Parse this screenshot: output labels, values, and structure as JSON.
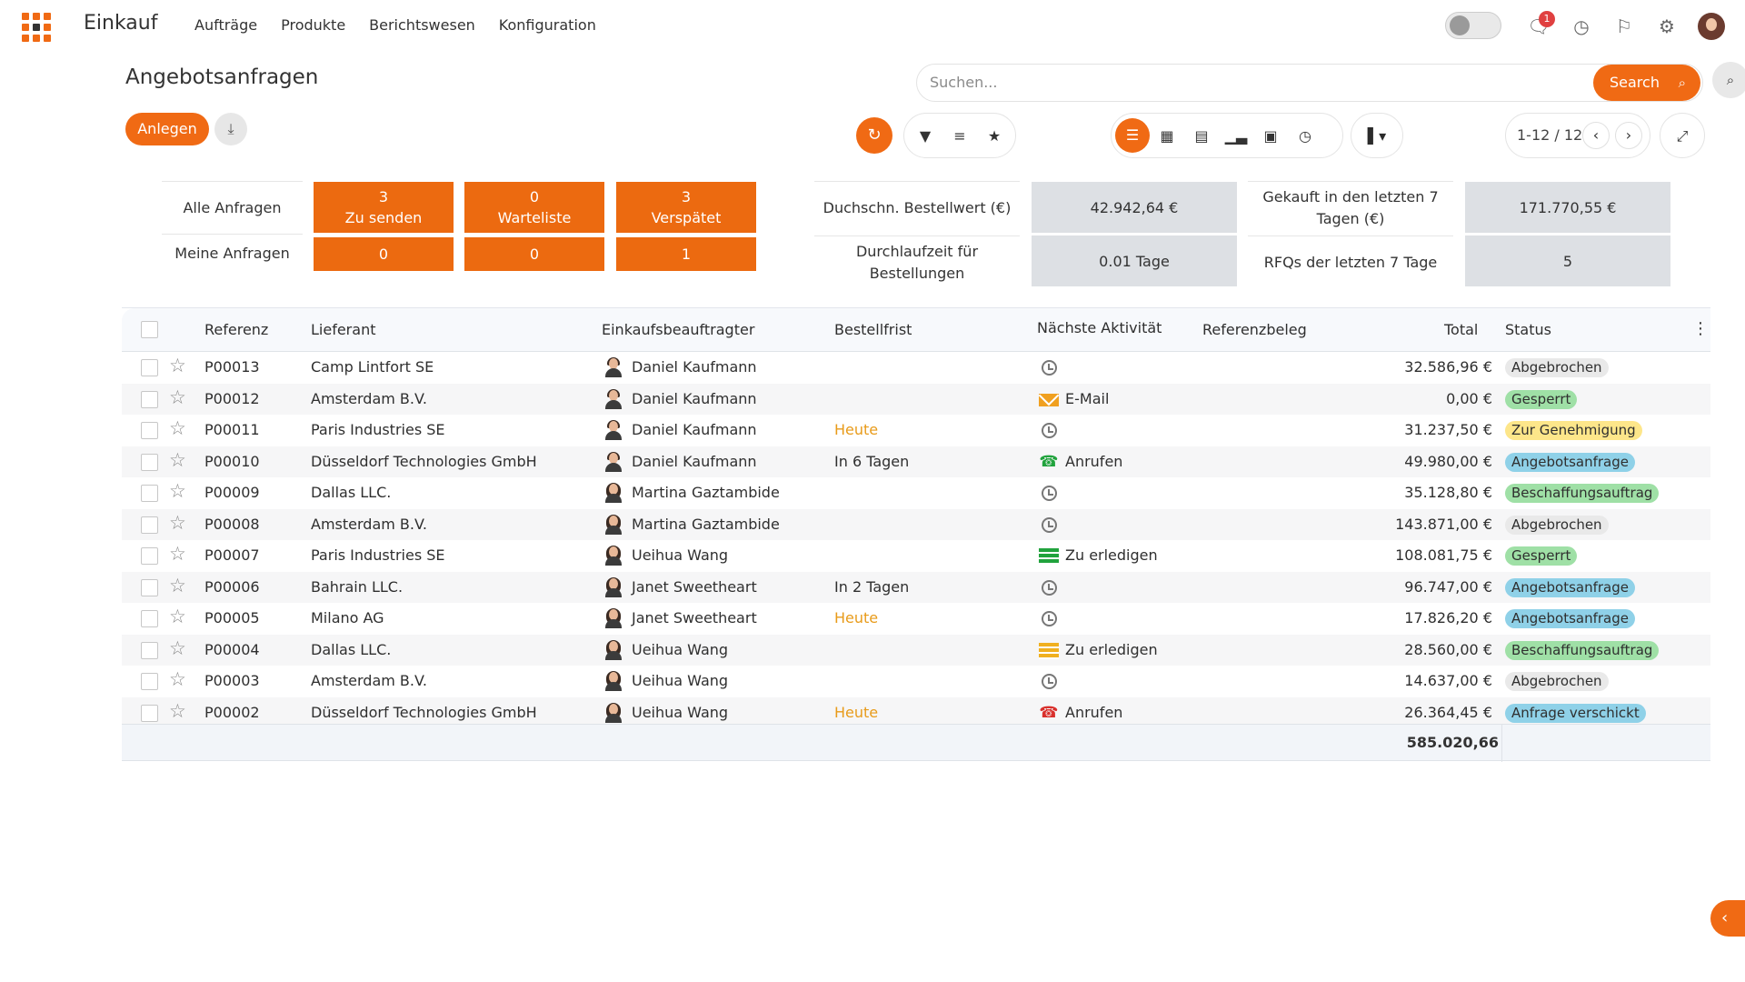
{
  "app": {
    "title": "Einkauf"
  },
  "nav": {
    "items": [
      "Aufträge",
      "Produkte",
      "Berichtswesen",
      "Konfiguration"
    ]
  },
  "header": {
    "notification_count": "1"
  },
  "page": {
    "title": "Angebotsanfragen"
  },
  "search": {
    "placeholder": "Suchen...",
    "button_label": "Search"
  },
  "actions": {
    "create_label": "Anlegen"
  },
  "pager": {
    "range": "1-12 / 12"
  },
  "dashboard": {
    "row_labels": [
      "Alle Anfragen",
      "Meine Anfragen"
    ],
    "tiles": [
      {
        "count_all": "3",
        "label": "Zu senden",
        "count_mine": "0"
      },
      {
        "count_all": "0",
        "label": "Warteliste",
        "count_mine": "0"
      },
      {
        "count_all": "3",
        "label": "Verspätet",
        "count_mine": "1"
      }
    ],
    "kpis": [
      {
        "label": "Duchschn. Bestellwert (€)",
        "value": "42.942,64 €"
      },
      {
        "label": "Gekauft in den letzten 7 Tagen (€)",
        "value": "171.770,55 €"
      },
      {
        "label": "Durchlaufzeit für Bestellungen",
        "value": "0.01  Tage"
      },
      {
        "label": "RFQs der letzten 7 Tage",
        "value": "5"
      }
    ]
  },
  "table": {
    "columns": [
      "Referenz",
      "Lieferant",
      "Einkaufsbeauftragter",
      "Bestellfrist",
      "Nächste Aktivität",
      "Referenzbeleg",
      "Total",
      "Status"
    ],
    "rows": [
      {
        "ref": "P00013",
        "supplier": "Camp Lintfort SE",
        "buyer": "Daniel Kaufmann",
        "deadline": "",
        "activity": "",
        "activity_icon": "clock-icon",
        "total": "32.586,96 €",
        "status": "Abgebrochen",
        "status_color": "#e9e9e9"
      },
      {
        "ref": "P00012",
        "supplier": "Amsterdam B.V.",
        "buyer": "Daniel Kaufmann",
        "deadline": "",
        "activity": "E-Mail",
        "activity_icon": "envelope-icon",
        "total": "0,00 €",
        "status": "Gesperrt",
        "status_color": "#9fe0a6"
      },
      {
        "ref": "P00011",
        "supplier": "Paris Industries SE",
        "buyer": "Daniel Kaufmann",
        "deadline": "Heute",
        "activity": "",
        "activity_icon": "clock-icon",
        "total": "31.237,50 €",
        "status": "Zur Genehmigung",
        "status_color": "#fde68a"
      },
      {
        "ref": "P00010",
        "supplier": "Düsseldorf Technologies GmbH",
        "buyer": "Daniel Kaufmann",
        "deadline": "In 6 Tagen",
        "activity": "Anrufen",
        "activity_icon": "phone-icon",
        "total": "49.980,00 €",
        "status": "Angebotsanfrage",
        "status_color": "#8fd1e8"
      },
      {
        "ref": "P00009",
        "supplier": "Dallas LLC.",
        "buyer": "Martina Gaztambide",
        "deadline": "",
        "activity": "",
        "activity_icon": "clock-icon",
        "total": "35.128,80 €",
        "status": "Beschaffungsauftrag",
        "status_color": "#9fe0a6"
      },
      {
        "ref": "P00008",
        "supplier": "Amsterdam B.V.",
        "buyer": "Martina Gaztambide",
        "deadline": "",
        "activity": "",
        "activity_icon": "clock-icon",
        "total": "143.871,00 €",
        "status": "Abgebrochen",
        "status_color": "#e9e9e9"
      },
      {
        "ref": "P00007",
        "supplier": "Paris Industries SE",
        "buyer": "Ueihua Wang",
        "deadline": "",
        "activity": "Zu erledigen",
        "activity_icon": "todo-icon",
        "total": "108.081,75 €",
        "status": "Gesperrt",
        "status_color": "#9fe0a6"
      },
      {
        "ref": "P00006",
        "supplier": "Bahrain LLC.",
        "buyer": "Janet Sweetheart",
        "deadline": "In 2 Tagen",
        "activity": "",
        "activity_icon": "clock-icon",
        "total": "96.747,00 €",
        "status": "Angebotsanfrage",
        "status_color": "#8fd1e8"
      },
      {
        "ref": "P00005",
        "supplier": "Milano AG",
        "buyer": "Janet Sweetheart",
        "deadline": "Heute",
        "activity": "",
        "activity_icon": "clock-icon",
        "total": "17.826,20 €",
        "status": "Angebotsanfrage",
        "status_color": "#8fd1e8"
      },
      {
        "ref": "P00004",
        "supplier": "Dallas LLC.",
        "buyer": "Ueihua Wang",
        "deadline": "",
        "activity": "Zu erledigen",
        "activity_icon": "todo-icon",
        "total": "28.560,00 €",
        "status": "Beschaffungsauftrag",
        "status_color": "#9fe0a6"
      },
      {
        "ref": "P00003",
        "supplier": "Amsterdam B.V.",
        "buyer": "Ueihua Wang",
        "deadline": "",
        "activity": "",
        "activity_icon": "clock-icon",
        "total": "14.637,00 €",
        "status": "Abgebrochen",
        "status_color": "#e9e9e9"
      },
      {
        "ref": "P00002",
        "supplier": "Düsseldorf Technologies GmbH",
        "buyer": "Ueihua Wang",
        "deadline": "Heute",
        "activity": "Anrufen",
        "activity_icon": "phone-icon",
        "total": "26.364,45 €",
        "status": "Anfrage verschickt",
        "status_color": "#8fd1e8"
      }
    ],
    "sum_total": "585.020,66"
  },
  "colors": {
    "accent": "#f06a14",
    "deadline_today": "#e89b1a"
  }
}
